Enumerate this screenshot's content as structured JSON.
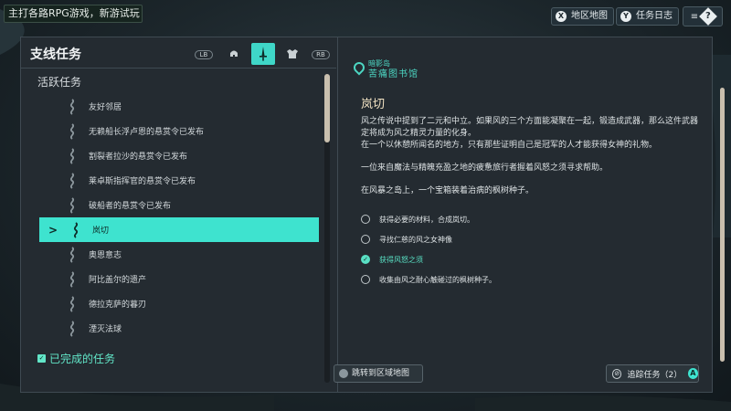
{
  "top_banner": {
    "text": "主打各路RPG游戏，新游试玩"
  },
  "top_buttons": {
    "region_map": {
      "key": "X",
      "label": "地区地图"
    },
    "quest_log": {
      "key": "Y",
      "label": "任务日志"
    },
    "help": {
      "key": "≡",
      "icon": "?"
    }
  },
  "left_panel": {
    "title": "支线任务",
    "tabs": [
      {
        "label": "LB"
      },
      {
        "icon": "helmet-icon"
      },
      {
        "icon": "sword-icon",
        "active": true
      },
      {
        "icon": "armor-icon"
      },
      {
        "label": "RB"
      }
    ],
    "active_section": "活跃任务",
    "quests": [
      {
        "label": "友好邻居"
      },
      {
        "label": "无赖船长浮卢恩的悬赏令已发布"
      },
      {
        "label": "割裂者拉沙的悬赏令已发布"
      },
      {
        "label": "莱卓斯指挥官的悬赏令已发布"
      },
      {
        "label": "破船者的悬赏令已发布"
      },
      {
        "label": "岚切",
        "selected": true
      },
      {
        "label": "奥恩意志"
      },
      {
        "label": "阿比盖尔的遗产"
      },
      {
        "label": "德拉克萨的暮刃"
      },
      {
        "label": "湮灭法球"
      }
    ],
    "completed_section": "已完成的任务"
  },
  "right_panel": {
    "location_region": "暗影岛",
    "location_name": "苦痛图书馆",
    "quest_title": "岚切",
    "description": [
      "风之传说中提到了二元和中立。如果风的三个方面能凝聚在一起，锻造成武器，那么这件武器定将成为风之精灵力量的化身。",
      "在一个以休憩所闻名的地方，只有那些证明自己是冠军的人才能获得女神的礼物。",
      "一位来自魔法与精魄充盈之地的疲惫旅行者握着风怒之须寻求帮助。",
      "在风暴之岛上，一个宝箱装着治病的枫树种子。"
    ],
    "objectives": [
      {
        "label": "获得必要的材料，合成岚切。",
        "done": false
      },
      {
        "label": "寻找仁慈的风之女神像",
        "done": false
      },
      {
        "label": "获得风怒之须",
        "done": true
      },
      {
        "label": "收集由风之耐心触碰过的枫树种子。",
        "done": false
      }
    ]
  },
  "bottom_buttons": {
    "jump_to_map": "跳转到区域地图",
    "track_quest": "追踪任务（2）",
    "track_key": "A"
  },
  "colors": {
    "accent": "#3ee3cf",
    "title_gold": "#f3e3c4",
    "panel_bg": "#242b31"
  }
}
